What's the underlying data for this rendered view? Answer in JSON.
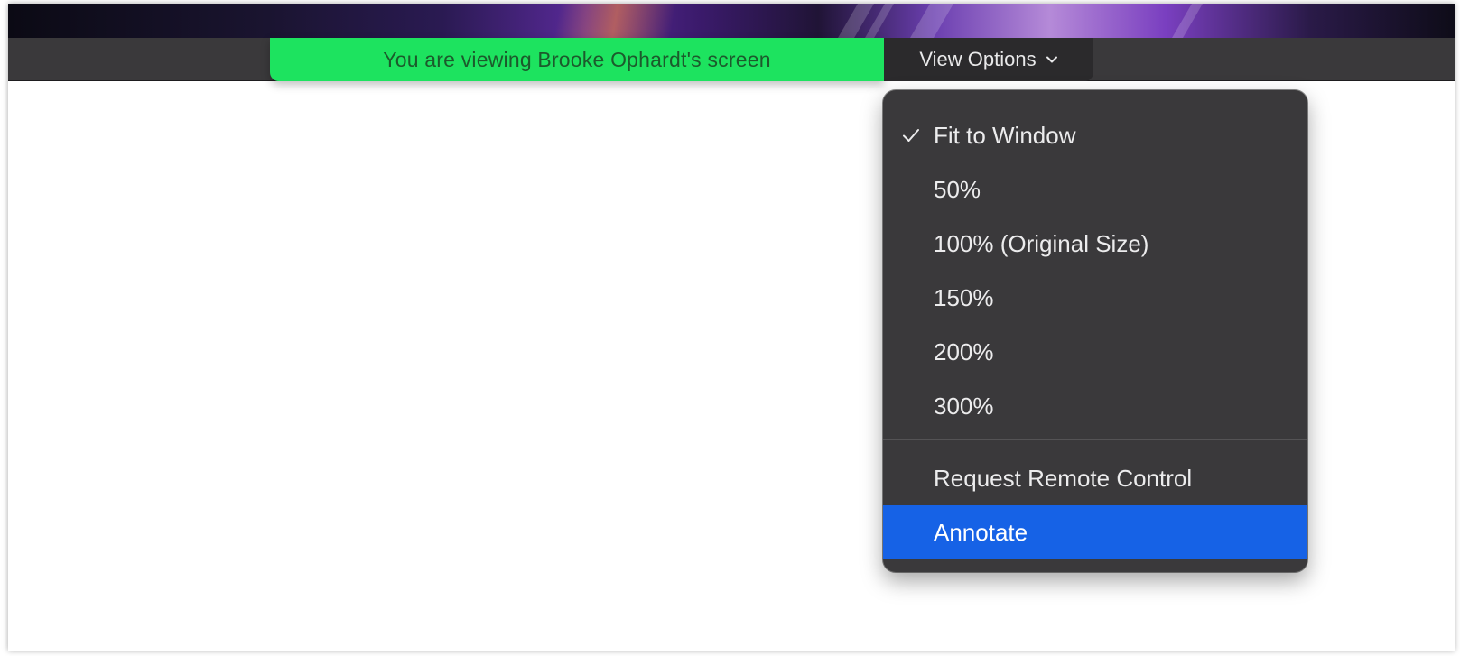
{
  "banner": {
    "viewing_text": "You are viewing Brooke Ophardt's screen",
    "view_options_label": "View Options"
  },
  "menu": {
    "items": [
      {
        "label": "Fit to Window",
        "checked": true
      },
      {
        "label": "50%"
      },
      {
        "label": "100% (Original Size)"
      },
      {
        "label": "150%"
      },
      {
        "label": "200%"
      },
      {
        "label": "300%"
      },
      {
        "label": "Request Remote Control"
      },
      {
        "label": "Annotate",
        "highlighted": true
      }
    ]
  },
  "colors": {
    "banner_green": "#1de35f",
    "menu_background": "#3a393b",
    "highlight_blue": "#1662e6"
  },
  "icons": {
    "checkmark": "checkmark-icon",
    "chevron": "chevron-down-icon"
  }
}
